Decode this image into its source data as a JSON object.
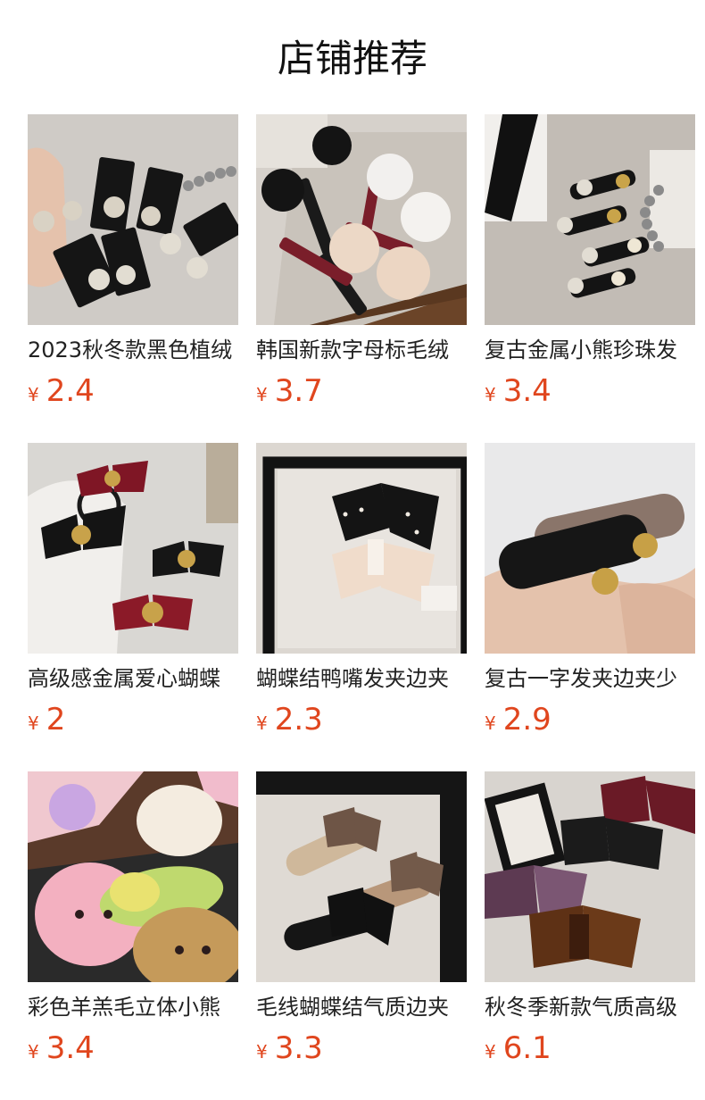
{
  "page": {
    "title": "店铺推荐"
  },
  "currency_symbol": "¥",
  "colors": {
    "price": "#e0461e",
    "title": "#111111",
    "name": "#222222"
  },
  "products": [
    {
      "name": "2023秋冬款黑色植绒",
      "price": "2.4",
      "image": "black-velvet-pearl-clips-photo"
    },
    {
      "name": "韩国新款字母标毛绒",
      "price": "3.7",
      "image": "plush-pompom-hair-clips-photo"
    },
    {
      "name": "复古金属小熊珍珠发",
      "price": "3.4",
      "image": "bear-pearl-hair-clips-photo"
    },
    {
      "name": "高级感金属爱心蝴蝶",
      "price": "2",
      "image": "heart-velvet-bow-photo"
    },
    {
      "name": "蝴蝶结鸭嘴发夹边夹",
      "price": "2.3",
      "image": "bow-duckbill-clips-photo"
    },
    {
      "name": "复古一字发夹边夹少",
      "price": "2.9",
      "image": "smiley-bar-clip-photo"
    },
    {
      "name": "彩色羊羔毛立体小熊",
      "price": "3.4",
      "image": "fluffy-bear-clips-photo"
    },
    {
      "name": "毛线蝴蝶结气质边夹",
      "price": "3.3",
      "image": "knit-bow-clips-photo"
    },
    {
      "name": "秋冬季新款气质高级",
      "price": "6.1",
      "image": "velvet-big-bow-clips-photo"
    }
  ]
}
